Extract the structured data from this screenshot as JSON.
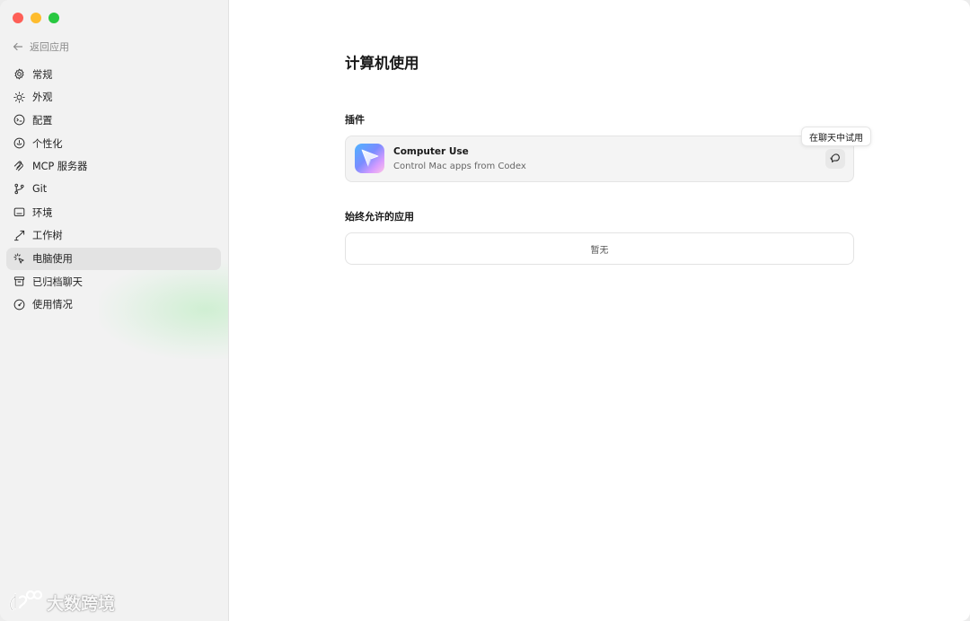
{
  "sidebar": {
    "back_label": "返回应用",
    "items": [
      {
        "label": "常规",
        "icon": "gear-icon"
      },
      {
        "label": "外观",
        "icon": "sun-icon"
      },
      {
        "label": "配置",
        "icon": "config-icon"
      },
      {
        "label": "个性化",
        "icon": "personalize-icon"
      },
      {
        "label": "MCP 服务器",
        "icon": "mcp-icon"
      },
      {
        "label": "Git",
        "icon": "git-branch-icon"
      },
      {
        "label": "环境",
        "icon": "monitor-icon"
      },
      {
        "label": "工作树",
        "icon": "worktree-icon"
      },
      {
        "label": "电脑使用",
        "icon": "cursor-sparkle-icon",
        "active": true
      },
      {
        "label": "已归档聊天",
        "icon": "archive-icon"
      },
      {
        "label": "使用情况",
        "icon": "gauge-icon"
      }
    ],
    "watermark": "大数跨境"
  },
  "main": {
    "title": "计算机使用",
    "plugins_label": "插件",
    "plugin": {
      "name": "Computer Use",
      "description": "Control Mac apps from Codex",
      "try_tooltip": "在聊天中试用"
    },
    "allowed_apps_label": "始终允许的应用",
    "allowed_apps_empty": "暂无"
  },
  "colors": {
    "active_item_bg": "#e3e3e3",
    "close": "#fe5f57",
    "minimize": "#febc2e",
    "maximize": "#28c840"
  }
}
